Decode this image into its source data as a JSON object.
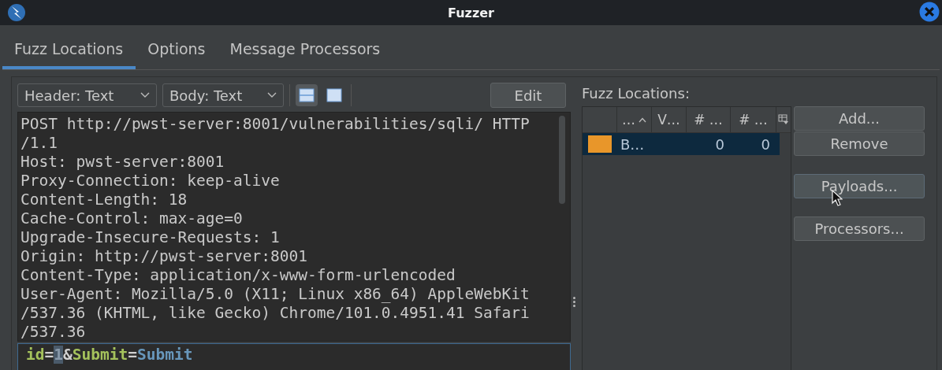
{
  "window": {
    "title": "Fuzzer"
  },
  "tabs": [
    {
      "label": "Fuzz Locations",
      "selected": true
    },
    {
      "label": "Options",
      "selected": false
    },
    {
      "label": "Message Processors",
      "selected": false
    }
  ],
  "toolbar": {
    "header_view": "Header: Text",
    "body_view": "Body: Text",
    "layouts": [
      {
        "kind": "split",
        "selected": true
      },
      {
        "kind": "single",
        "selected": false
      }
    ],
    "edit_button": "Edit"
  },
  "header_lines": [
    "POST http://pwst-server:8001/vulnerabilities/sqli/ HTTP",
    "/1.1",
    "Host: pwst-server:8001",
    "Proxy-Connection: keep-alive",
    "Content-Length: 18",
    "Cache-Control: max-age=0",
    "Upgrade-Insecure-Requests: 1",
    "Origin: http://pwst-server:8001",
    "Content-Type: application/x-www-form-urlencoded",
    "User-Agent: Mozilla/5.0 (X11; Linux x86_64) AppleWebKit",
    "/537.36 (KHTML, like Gecko) Chrome/101.0.4951.41 Safari",
    "/537.36"
  ],
  "body_tokens": [
    {
      "text": "id",
      "kind": "key",
      "selected": false
    },
    {
      "text": "=",
      "kind": "sep",
      "selected": false
    },
    {
      "text": "1",
      "kind": "value",
      "selected": true
    },
    {
      "text": "&",
      "kind": "sep",
      "selected": false
    },
    {
      "text": "Submit",
      "kind": "key",
      "selected": false
    },
    {
      "text": "=",
      "kind": "sep",
      "selected": false
    },
    {
      "text": "Submit",
      "kind": "value",
      "selected": false
    }
  ],
  "locations": {
    "label": "Fuzz Locations:",
    "columns": [
      {
        "sorted": false
      },
      {
        "label": "…",
        "sorted": true
      },
      {
        "label": "V…",
        "sorted": false
      },
      {
        "label": "# …",
        "sorted": false
      },
      {
        "label": "# …",
        "sorted": false
      }
    ],
    "rows": [
      {
        "color": "#e8962a",
        "cells": [
          "",
          "B…",
          "",
          "0",
          "0"
        ],
        "selected": true
      }
    ]
  },
  "buttons": [
    "Add...",
    "Remove",
    "Payloads...",
    "Processors..."
  ]
}
